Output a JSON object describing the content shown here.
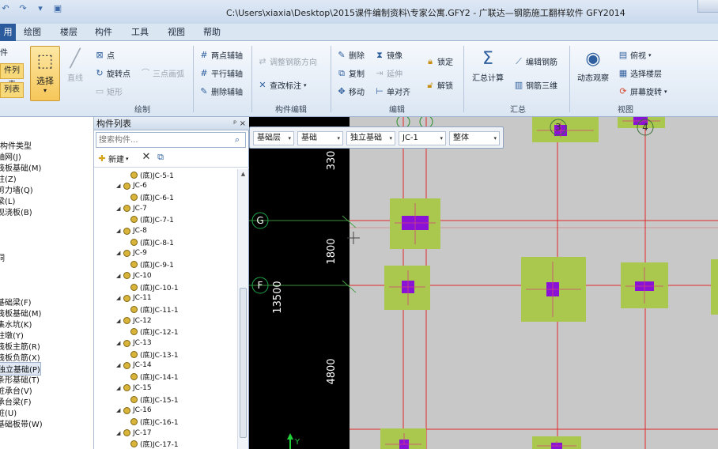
{
  "window": {
    "title": "C:\\Users\\xiaxia\\Desktop\\2015课件编制资料\\专家公寓.GFY2 - 广联达—钢筋施工翻样软件 GFY2014"
  },
  "menu": {
    "tabs": [
      "用",
      "绘图",
      "楼层",
      "构件",
      "工具",
      "视图",
      "帮助"
    ]
  },
  "ribbon": {
    "left_btn_1": "件列表",
    "left_btn_2": "列表",
    "select_label": "选择",
    "line_label": "直线",
    "point_label": "点",
    "rotate_point_label": "旋转点",
    "three_point_arc_label": "三点画弧",
    "rect_label": "矩形",
    "draw_group": "绘制",
    "two_point_axis_label": "两点辅轴",
    "parallel_axis_label": "平行辅轴",
    "delete_axis_label": "删除辅轴",
    "adjust_rebar_dir_label": "调整钢筋方向",
    "check_mark_label": "查改标注",
    "component_edit_group": "构件编辑",
    "delete_label": "删除",
    "mirror_label": "镜像",
    "lock_label": "锁定",
    "copy_label": "复制",
    "extend_label": "延伸",
    "unlock_label": "解锁",
    "move_label": "移动",
    "single_align_label": "单对齐",
    "edit_group": "编辑",
    "summary_calc_label": "汇总计算",
    "edit_rebar_label": "编辑钢筋",
    "rebar_3d_label": "钢筋三维",
    "summary_group": "汇总",
    "dynamic_view_label": "动态观察",
    "top_view_label": "俯视",
    "select_floor_label": "选择楼层",
    "screen_rotate_label": "屏幕旋转",
    "view_group": "视图"
  },
  "left_tree": {
    "items": [
      "构件类型",
      "轴网(J)",
      "筏板基础(M)",
      "柱(Z)",
      "剪力墙(Q)",
      "梁(L)",
      "现浇板(B)",
      "洞",
      "基础梁(F)",
      "筏板基础(M)",
      "集水坑(K)",
      "柱墩(Y)",
      "筏板主筋(R)",
      "筏板负筋(X)",
      "独立基础(P)",
      "条形基础(T)",
      "桩承台(V)",
      "承台梁(F)",
      "桩(U)",
      "基础板带(W)"
    ],
    "selected_index": 14
  },
  "component_panel": {
    "title": "构件列表",
    "pin_label": "ᵖ ×",
    "search_placeholder": "搜索构件...",
    "new_label": "新建",
    "rows": [
      {
        "label": "(底)JC-5-1",
        "level": 2
      },
      {
        "label": "JC-6",
        "level": 1
      },
      {
        "label": "(底)JC-6-1",
        "level": 2
      },
      {
        "label": "JC-7",
        "level": 1
      },
      {
        "label": "(底)JC-7-1",
        "level": 2
      },
      {
        "label": "JC-8",
        "level": 1
      },
      {
        "label": "(底)JC-8-1",
        "level": 2
      },
      {
        "label": "JC-9",
        "level": 1
      },
      {
        "label": "(底)JC-9-1",
        "level": 2
      },
      {
        "label": "JC-10",
        "level": 1
      },
      {
        "label": "(底)JC-10-1",
        "level": 2
      },
      {
        "label": "JC-11",
        "level": 1
      },
      {
        "label": "(底)JC-11-1",
        "level": 2
      },
      {
        "label": "JC-12",
        "level": 1
      },
      {
        "label": "(底)JC-12-1",
        "level": 2
      },
      {
        "label": "JC-13",
        "level": 1
      },
      {
        "label": "(底)JC-13-1",
        "level": 2
      },
      {
        "label": "JC-14",
        "level": 1
      },
      {
        "label": "(底)JC-14-1",
        "level": 2
      },
      {
        "label": "JC-15",
        "level": 1
      },
      {
        "label": "(底)JC-15-1",
        "level": 2
      },
      {
        "label": "JC-16",
        "level": 1
      },
      {
        "label": "(底)JC-16-1",
        "level": 2
      },
      {
        "label": "JC-17",
        "level": 1
      },
      {
        "label": "(底)JC-17-1",
        "level": 2
      }
    ]
  },
  "property_bar": {
    "floor": "基础层",
    "category": "基础",
    "type": "独立基础",
    "component": "JC-1",
    "scope": "整体"
  },
  "canvas": {
    "axis_labels": [
      "G",
      "F",
      "3",
      "4"
    ],
    "dimensions": [
      "330",
      "1800",
      "13500",
      "4800"
    ],
    "y_axis_label": "Y",
    "colors": {
      "background": "#000000",
      "work_area": "#c8c8c8",
      "footing_pad": "#a9c84d",
      "column": "#8a12d6",
      "grid_line": "#e0282c",
      "axis_bubble": "#1fa84a"
    }
  }
}
